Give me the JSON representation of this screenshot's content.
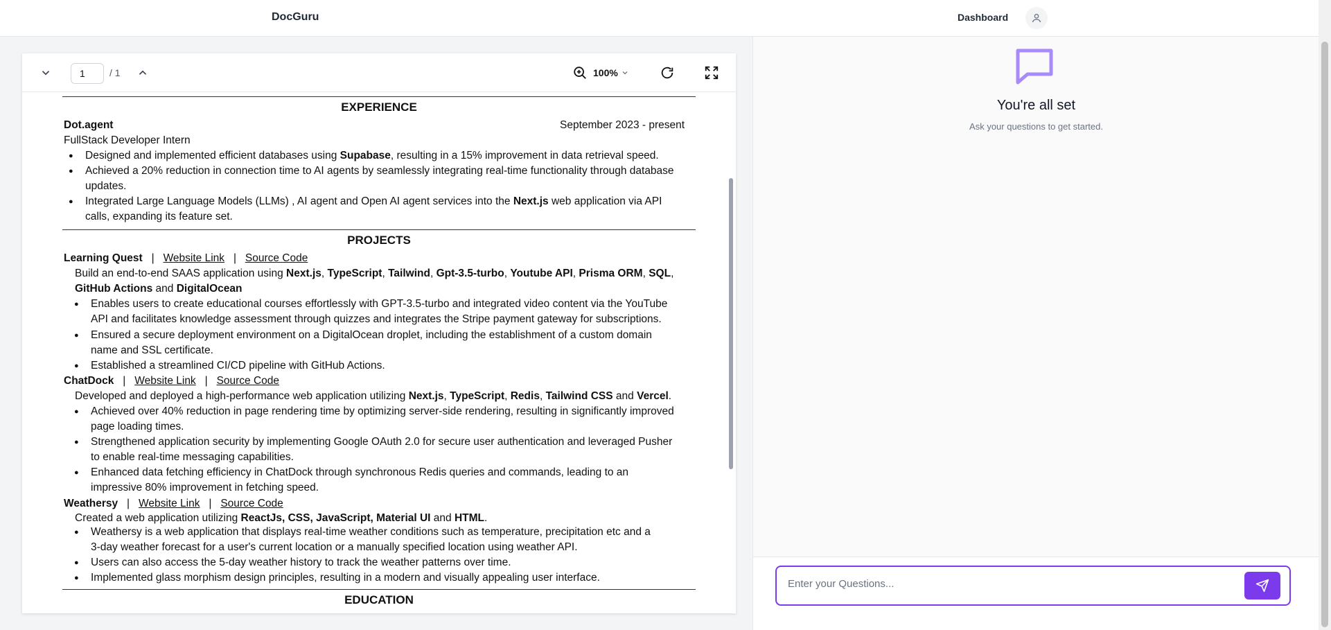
{
  "navbar": {
    "brand": "DocGuru",
    "dashboard_label": "Dashboard"
  },
  "toolbar": {
    "page_value": "1",
    "page_total": "/ 1",
    "zoom": "100%"
  },
  "colors": {
    "accent": "#7c3aed",
    "icon_light": "#a78bfa"
  },
  "resume": {
    "experience_heading": "EXPERIENCE",
    "company": "Dot.agent",
    "dates": "September 2023 - present",
    "role": "FullStack Developer Intern",
    "exp_b1_a": "Designed and implemented efficient databases using ",
    "exp_b1_b": "Supabase",
    "exp_b1_c": ", resulting in a 15% improvement in data retrieval speed.",
    "exp_b2_l1": "Achieved a 20% reduction in connection time to AI agents by seamlessly integrating real-time functionality through database",
    "exp_b2_l2": "updates.",
    "exp_b3_a": "Integrated Large Language Models (LLMs) , AI agent and Open AI agent  services into the ",
    "exp_b3_b": "Next.js",
    "exp_b3_c": " web application via API",
    "exp_b3_l2": "calls, expanding its feature set.",
    "projects_heading": "PROJECTS",
    "sep": "|",
    "website_link": "Website Link",
    "source_code": "Source Code",
    "p1": {
      "name": "Learning Quest",
      "desc_a": "Build an end-to-end SAAS application using ",
      "t1": "Next.js",
      "t2": "TypeScript",
      "t3": "Tailwind",
      "t4": "Gpt-3.5-turbo",
      "t5": "Youtube API",
      "t6": "Prisma ORM",
      "t7": "SQL",
      "t8": "GitHub Actions",
      "and": " and ",
      "t9": "DigitalOcean",
      "b1_l1": "Enables users to create educational courses effortlessly with GPT-3.5-turbo and integrated video content via the YouTube",
      "b1_l2": "API and facilitates knowledge assessment through quizzes and integrates the Stripe payment gateway for subscriptions.",
      "b2_l1": "Ensured a secure deployment environment on a DigitalOcean droplet, including the establishment of a custom domain",
      "b2_l2": "name and SSL certificate.",
      "b3": "Established a streamlined CI/CD pipeline with GitHub Actions."
    },
    "p2": {
      "name": "ChatDock",
      "desc_a": "Developed and deployed a high-performance web application utilizing ",
      "t1": "Next.js",
      "t2": "TypeScript",
      "t3": "Redis",
      "t4": "Tailwind CSS",
      "t5": "Vercel",
      "b1_l1": "Achieved over 40% reduction in page rendering time by optimizing server-side rendering, resulting in significantly improved",
      "b1_l2": "page loading times.",
      "b2_l1": "Strengthened application security by implementing Google OAuth 2.0 for secure user authentication and leveraged Pusher",
      "b2_l2": "to enable real-time messaging capabilities.",
      "b3_l1": "Enhanced data fetching efficiency in ChatDock through synchronous Redis queries and commands, leading to an",
      "b3_l2": "impressive 80% improvement in fetching speed."
    },
    "p3": {
      "name": "Weathersy",
      "desc_a": "Created a web application utilizing ",
      "t1": "ReactJs, CSS, JavaScript, Material UI",
      "t2": "HTML",
      "b1_l1": "Weathersy is a web application that displays real-time weather conditions such as temperature, precipitation etc and a",
      "b1_l2": "3-day weather forecast for a user's current location or a manually specified location using weather API.",
      "b2": "Users can also access the 5-day weather history to track the weather patterns over time.",
      "b3": "Implemented glass morphism design principles, resulting in a modern and visually appealing user interface."
    },
    "education_heading": "EDUCATION"
  },
  "chat": {
    "empty_title": "You're all set",
    "empty_subtitle": "Ask your questions to get started.",
    "input_placeholder": "Enter your Questions..."
  }
}
